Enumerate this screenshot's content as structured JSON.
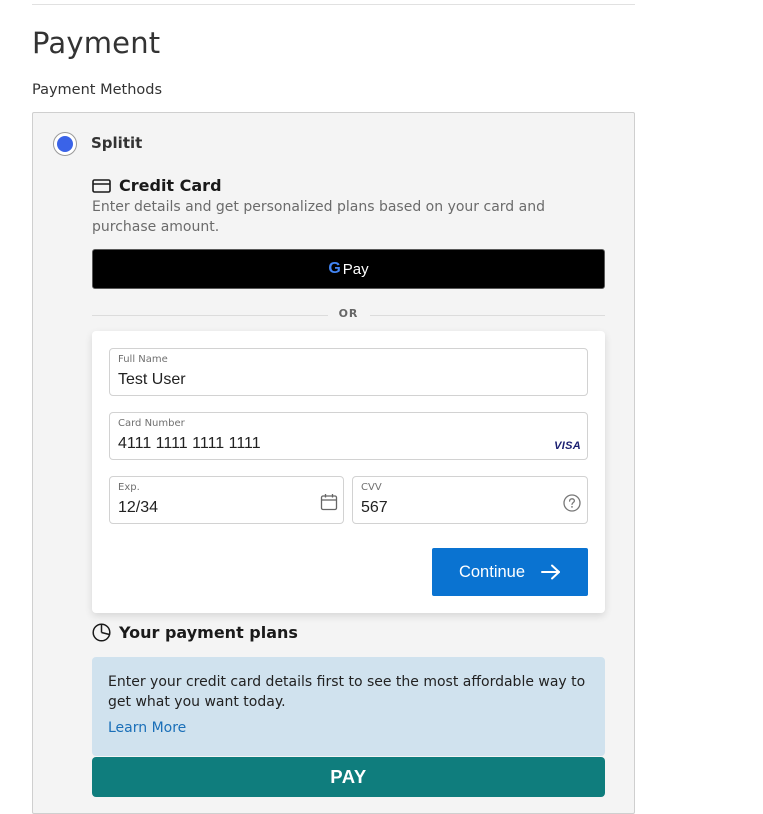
{
  "page": {
    "title": "Payment",
    "section_label": "Payment Methods"
  },
  "method": {
    "name": "Splitit",
    "selected": true,
    "accent_color": "#3a63e8"
  },
  "credit_card": {
    "title": "Credit Card",
    "icon": "credit-card-icon",
    "description": "Enter details and get personalized plans based on your card and purchase amount."
  },
  "gpay": {
    "g": "G",
    "label": "Pay"
  },
  "divider": {
    "text": "OR"
  },
  "form": {
    "full_name": {
      "label": "Full Name",
      "value": "Test User"
    },
    "card_number": {
      "label": "Card Number",
      "value": "4111 1111 1111 1111",
      "brand": "VISA"
    },
    "exp": {
      "label": "Exp.",
      "value": "12/34",
      "icon": "calendar-icon"
    },
    "cvv": {
      "label": "CVV",
      "value": "567",
      "icon": "help-circle-icon"
    },
    "continue_label": "Continue",
    "continue_color": "#0a73d1"
  },
  "plans": {
    "title": "Your payment plans",
    "icon": "pie-chart-icon",
    "info_text": "Enter your credit card details first to see the most affordable way to get what you want today.",
    "learn_more": "Learn More"
  },
  "pay_button": {
    "label": "PAY",
    "color": "#0f7d7d"
  }
}
